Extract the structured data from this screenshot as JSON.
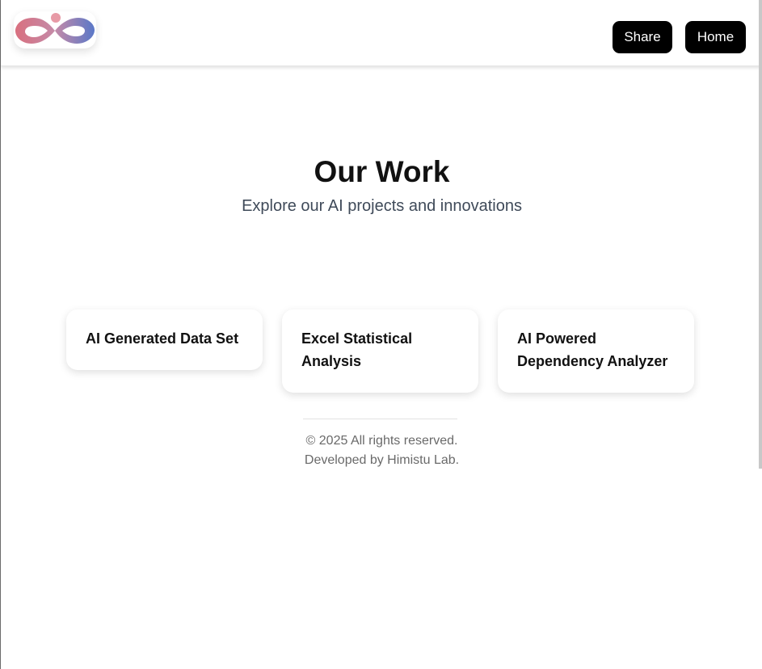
{
  "header": {
    "logo_icon": "infinity-logo-icon",
    "share_label": "Share",
    "home_label": "Home"
  },
  "hero": {
    "title": "Our Work",
    "subtitle": "Explore our AI projects and innovations"
  },
  "cards": [
    {
      "title": "AI Generated Data Set"
    },
    {
      "title": "Excel Statistical Analysis"
    },
    {
      "title": "AI Powered Dependency Analyzer"
    }
  ],
  "footer": {
    "copyright": "© 2025 All rights reserved.",
    "developed_by": "Developed by Himistu Lab."
  },
  "colors": {
    "button_bg": "#000000",
    "subtitle": "#3f4a59",
    "footer_text": "#6a6a6a",
    "logo_gradient": [
      "#e08a9a",
      "#b06fa0",
      "#6a7fc4"
    ]
  }
}
